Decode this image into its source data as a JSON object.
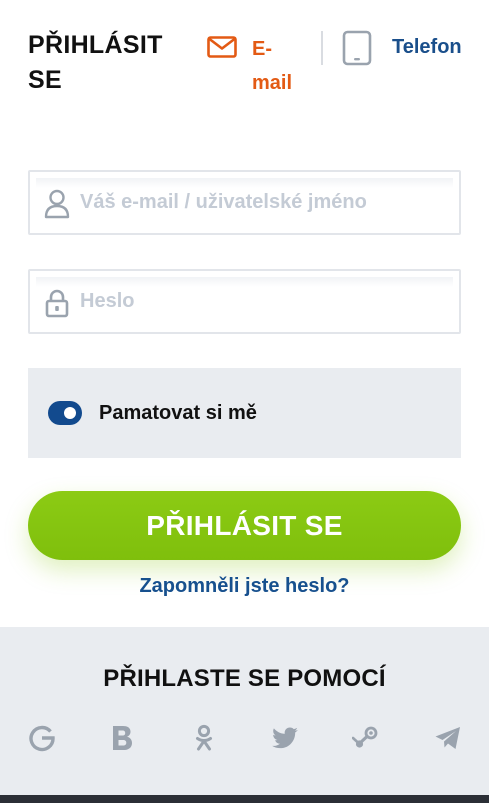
{
  "header": {
    "title": "PŘIHLÁSIT SE",
    "tabs": [
      {
        "label": "E-mail",
        "icon": "mail-icon",
        "active": true,
        "color": "#e35a14"
      },
      {
        "label": "Telefon",
        "icon": "phone-icon",
        "active": false,
        "color": "#1a4f8b"
      }
    ]
  },
  "form": {
    "email_placeholder": "Váš e-mail / uživatelské jméno",
    "email_value": "",
    "email_icon": "user-icon",
    "password_placeholder": "Heslo",
    "password_value": "",
    "password_icon": "lock-icon",
    "remember_label": "Pamatovat si mě",
    "remember_checked": true,
    "submit_label": "PŘIHLÁSIT SE",
    "forgot_label": "Zapomněli jste heslo?"
  },
  "social": {
    "heading": "PŘIHLASTE SE POMOCÍ",
    "providers": [
      {
        "name": "google",
        "icon": "google-icon"
      },
      {
        "name": "b",
        "icon": "b-letter-icon"
      },
      {
        "name": "odnoklassniki",
        "icon": "odnoklassniki-icon"
      },
      {
        "name": "twitter",
        "icon": "twitter-icon"
      },
      {
        "name": "steam",
        "icon": "steam-icon"
      },
      {
        "name": "telegram",
        "icon": "telegram-icon"
      }
    ]
  },
  "colors": {
    "accent_orange": "#e35a14",
    "link_blue": "#1a4f8b",
    "toggle_blue": "#124a8e",
    "submit_green": "#86c511",
    "panel_gray": "#e9ecf0",
    "icon_gray": "#9aa3ae"
  }
}
